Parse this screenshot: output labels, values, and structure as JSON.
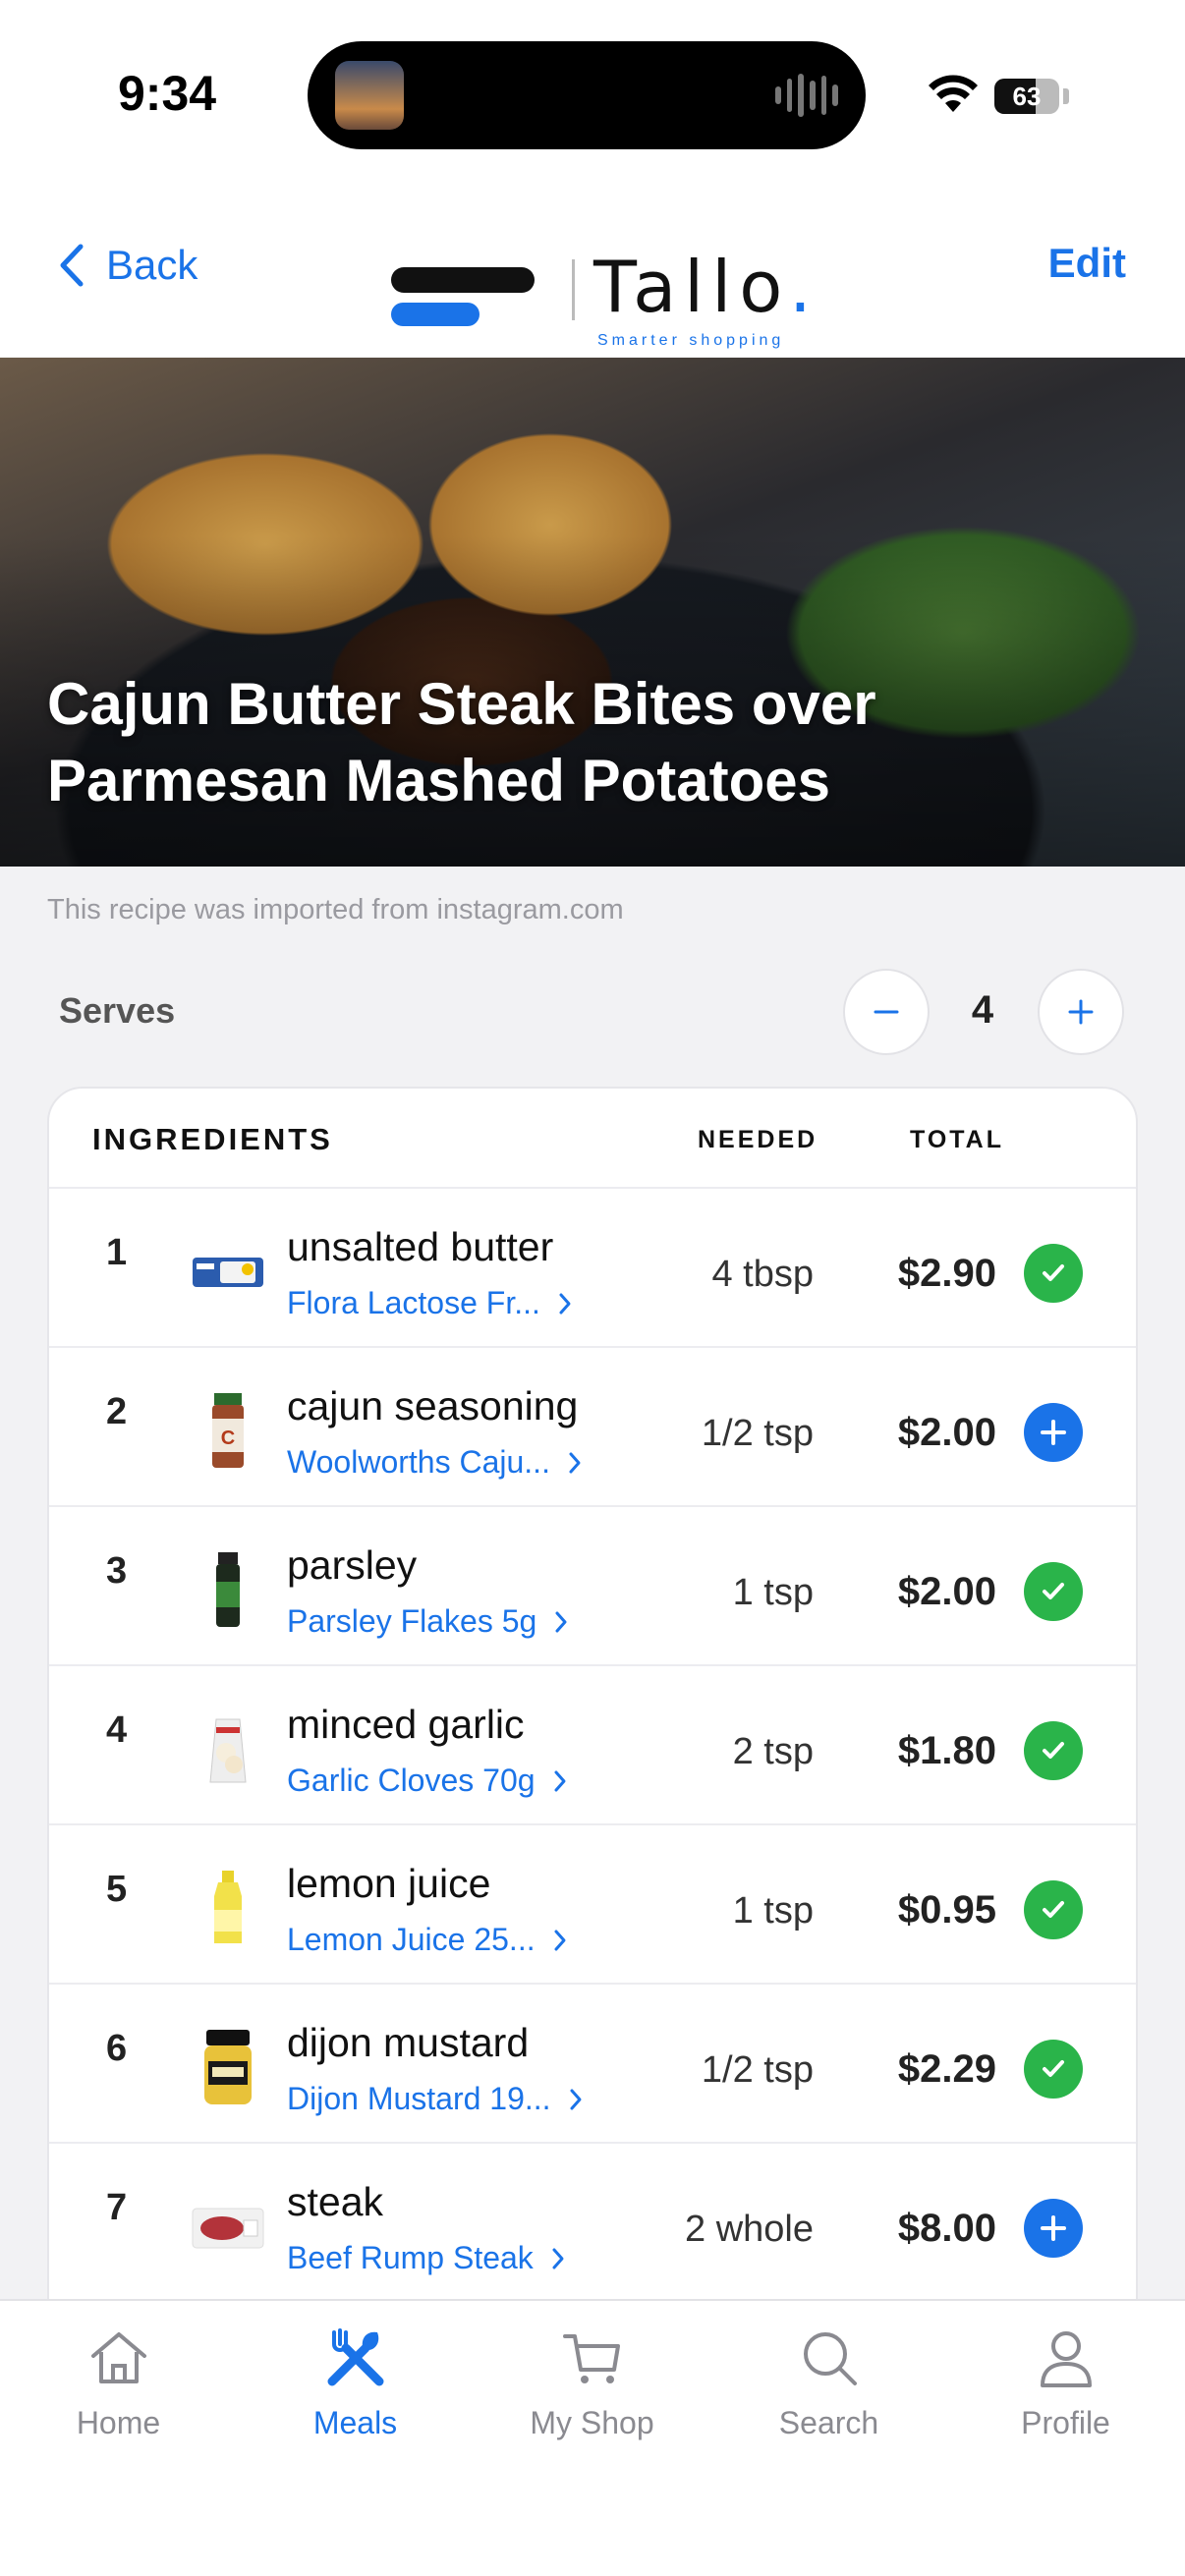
{
  "status_bar": {
    "time": "9:34",
    "battery": "63",
    "battery_level": 0.63
  },
  "nav": {
    "back_label": "Back",
    "edit_label": "Edit",
    "logo_word": "Tallo",
    "logo_dot": ".",
    "logo_tagline": "Smarter shopping"
  },
  "recipe": {
    "title": "Cajun Butter Steak Bites over Parmesan Mashed Potatoes",
    "source_note": "This recipe was imported from instagram.com",
    "serves_label": "Serves",
    "serves": "4"
  },
  "ingredients": {
    "header": {
      "ingredients": "INGREDIENTS",
      "needed": "NEEDED",
      "total": "TOTAL"
    },
    "items": [
      {
        "num": "1",
        "name": "unsalted butter",
        "product": "Flora Lactose Fr...",
        "needed": "4 tbsp",
        "total": "$2.90",
        "status": "done",
        "thumb": "butter-tub"
      },
      {
        "num": "2",
        "name": "cajun seasoning",
        "product": "Woolworths Caju...",
        "needed": "1/2 tsp",
        "total": "$2.00",
        "status": "add",
        "thumb": "spice-jar"
      },
      {
        "num": "3",
        "name": "parsley",
        "product": "Parsley Flakes 5g",
        "needed": "1 tsp",
        "total": "$2.00",
        "status": "done",
        "thumb": "herb-jar"
      },
      {
        "num": "4",
        "name": "minced garlic",
        "product": "Garlic Cloves 70g",
        "needed": "2 tsp",
        "total": "$1.80",
        "status": "done",
        "thumb": "garlic-bag"
      },
      {
        "num": "5",
        "name": "lemon juice",
        "product": "Lemon Juice 25...",
        "needed": "1 tsp",
        "total": "$0.95",
        "status": "done",
        "thumb": "lemon-bottle"
      },
      {
        "num": "6",
        "name": "dijon mustard",
        "product": "Dijon Mustard 19...",
        "needed": "1/2 tsp",
        "total": "$2.29",
        "status": "done",
        "thumb": "mustard-jar"
      },
      {
        "num": "7",
        "name": "steak",
        "product": "Beef Rump Steak",
        "needed": "2 whole",
        "total": "$8.00",
        "status": "add",
        "thumb": "steak-pack"
      }
    ]
  },
  "tabs": [
    {
      "label": "Home",
      "icon": "home-icon",
      "active": false
    },
    {
      "label": "Meals",
      "icon": "fork-knife-icon",
      "active": true
    },
    {
      "label": "My Shop",
      "icon": "cart-icon",
      "active": false
    },
    {
      "label": "Search",
      "icon": "search-icon",
      "active": false
    },
    {
      "label": "Profile",
      "icon": "person-icon",
      "active": false
    }
  ],
  "colors": {
    "accent": "#1a73e8",
    "done": "#2ab44a",
    "inactive": "#8a8a90"
  }
}
